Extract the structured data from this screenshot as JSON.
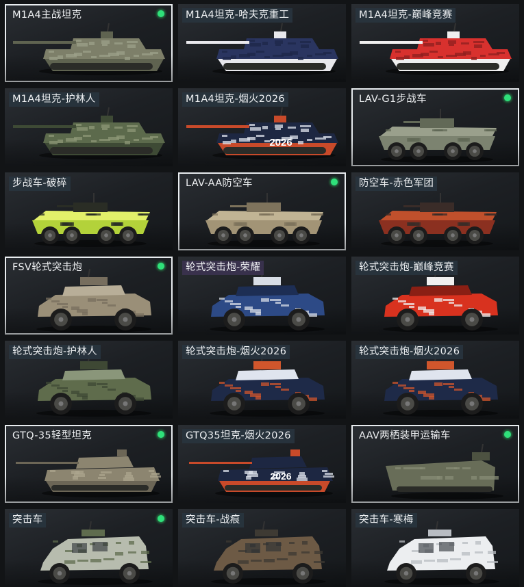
{
  "items": [
    {
      "name": "M1A4主战坦克",
      "kind": "tank",
      "selected": true,
      "badge": true,
      "colors": [
        "#7d7f69",
        "#5f6350",
        "#9ca08a"
      ]
    },
    {
      "name": "M1A4坦克-哈夫克重工",
      "kind": "tank",
      "selected": false,
      "badge": false,
      "colors": [
        "#2a3560",
        "#e8e8ec",
        "#1e2748"
      ]
    },
    {
      "name": "M1A4坦克-巅峰竞赛",
      "kind": "tank",
      "selected": false,
      "badge": false,
      "colors": [
        "#d8312e",
        "#efefef",
        "#8e1f1f"
      ]
    },
    {
      "name": "M1A4坦克-护林人",
      "kind": "tank",
      "selected": false,
      "badge": false,
      "colors": [
        "#5c6a4c",
        "#3e4a35",
        "#8d9877"
      ]
    },
    {
      "name": "M1A4坦克-烟火2026",
      "kind": "tank2026",
      "selected": false,
      "badge": false,
      "colors": [
        "#1d2742",
        "#c84a2a",
        "#dfe4ee"
      ]
    },
    {
      "name": "LAV-G1步战车",
      "kind": "apc",
      "selected": true,
      "badge": true,
      "colors": [
        "#7c8370",
        "#626957",
        "#9aa08c"
      ]
    },
    {
      "name": "步战车-破碎",
      "kind": "apc",
      "selected": false,
      "badge": false,
      "colors": [
        "#b3d23a",
        "#2a2d25",
        "#e2f06a"
      ]
    },
    {
      "name": "LAV-AA防空车",
      "kind": "apc",
      "selected": true,
      "badge": true,
      "colors": [
        "#a29476",
        "#7e735c",
        "#c1b494"
      ]
    },
    {
      "name": "防空车-赤色军团",
      "kind": "apc",
      "selected": false,
      "badge": false,
      "colors": [
        "#8b3020",
        "#3a2c28",
        "#c0502c"
      ]
    },
    {
      "name": "FSV轮式突击炮",
      "kind": "car",
      "selected": true,
      "badge": true,
      "colors": [
        "#9a8f78",
        "#776e5e",
        "#b8ae98"
      ]
    },
    {
      "name": "轮式突击炮-荣耀",
      "kind": "car",
      "selected": false,
      "badge": false,
      "colors": [
        "#2d4a86",
        "#d8dde6",
        "#1d2e54"
      ],
      "highlight": true
    },
    {
      "name": "轮式突击炮-巅峰竞赛",
      "kind": "car",
      "selected": false,
      "badge": false,
      "colors": [
        "#d8321f",
        "#f0f0f0",
        "#8a1f14"
      ]
    },
    {
      "name": "轮式突击炮-护林人",
      "kind": "car",
      "selected": false,
      "badge": false,
      "colors": [
        "#5f6c4c",
        "#3e4834",
        "#8a967a"
      ]
    },
    {
      "name": "轮式突击炮-烟火2026",
      "kind": "car",
      "selected": false,
      "badge": false,
      "colors": [
        "#1e2a48",
        "#d0562c",
        "#dfe4ee"
      ]
    },
    {
      "name": "轮式突击炮-烟火2026",
      "kind": "car",
      "selected": false,
      "badge": false,
      "colors": [
        "#1e2a48",
        "#d0562c",
        "#dfe4ee"
      ]
    },
    {
      "name": "GTQ-35轻型坦克",
      "kind": "ltank",
      "selected": true,
      "badge": true,
      "colors": [
        "#8c8570",
        "#6c6656",
        "#aca58e"
      ]
    },
    {
      "name": "GTQ35坦克-烟火2026",
      "kind": "ltank2026",
      "selected": false,
      "badge": false,
      "colors": [
        "#1d2742",
        "#c84a2a",
        "#dfe4ee"
      ]
    },
    {
      "name": "AAV两栖装甲运输车",
      "kind": "aav",
      "selected": true,
      "badge": true,
      "colors": [
        "#686d58",
        "#4d5241",
        "#878c75"
      ]
    },
    {
      "name": "突击车",
      "kind": "mrap",
      "selected": false,
      "badge": true,
      "colors": [
        "#b7bcae",
        "#5f6c4e",
        "#dcdfd6"
      ]
    },
    {
      "name": "突击车-战痕",
      "kind": "mrap",
      "selected": false,
      "badge": false,
      "colors": [
        "#6d5a45",
        "#3e3a33",
        "#8f7b62"
      ]
    },
    {
      "name": "突击车-寒梅",
      "kind": "mrap",
      "selected": false,
      "badge": false,
      "colors": [
        "#eceef0",
        "#b8bcc2",
        "#c0392b"
      ]
    }
  ]
}
